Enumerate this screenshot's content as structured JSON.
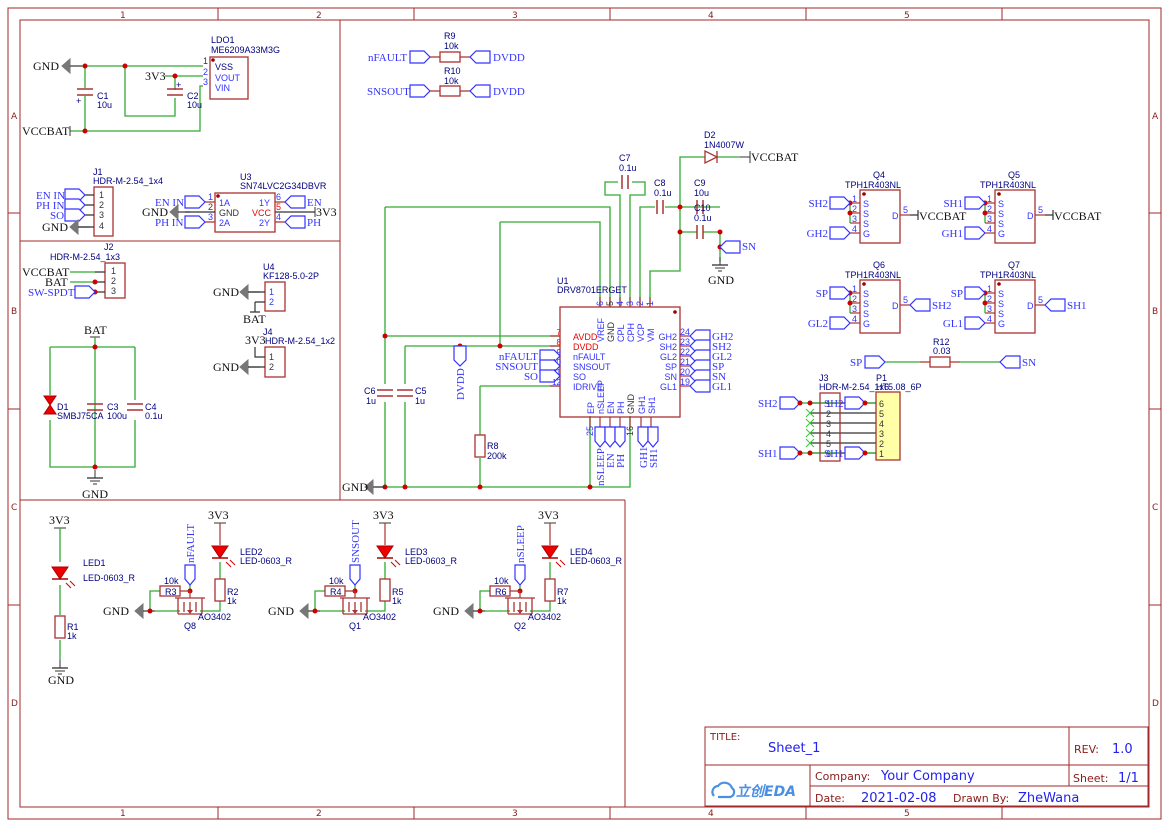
{
  "frame": {
    "columns": [
      "1",
      "2",
      "3",
      "4",
      "5"
    ],
    "rows": [
      "A",
      "B",
      "C",
      "D"
    ]
  },
  "power": {
    "gnd": "GND",
    "vccbat": "VCCBAT",
    "v3": "3V3",
    "bat": "BAT",
    "ldo": {
      "ref": "LDO1",
      "part": "ME6209A33M3G",
      "pins": [
        "VSS",
        "VOUT",
        "VIN"
      ],
      "nums": [
        "1",
        "2",
        "3"
      ]
    },
    "c1": {
      "ref": "C1",
      "val": "10u"
    },
    "c2": {
      "ref": "C2",
      "val": "10u"
    }
  },
  "j1": {
    "ref": "J1",
    "part": "HDR-M-2.54_1x4",
    "pins": [
      "1",
      "2",
      "3",
      "4"
    ],
    "nets": [
      "EN IN",
      "PH IN",
      "SO",
      "GND"
    ]
  },
  "u3": {
    "ref": "U3",
    "part": "SN74LVC2G34DBVR",
    "left_pins": [
      "1A",
      "GND",
      "2A"
    ],
    "left_nums": [
      "1",
      "2",
      "3"
    ],
    "right_pins": [
      "1Y",
      "VCC",
      "2Y"
    ],
    "right_nums": [
      "6",
      "5",
      "4"
    ],
    "left_nets": [
      "EN IN",
      "GND",
      "PH IN"
    ],
    "right_nets": [
      "EN",
      "3V3",
      "PH"
    ]
  },
  "j2": {
    "ref": "J2",
    "part": "HDR-M-2.54_1x3",
    "pins": [
      "1",
      "2",
      "3"
    ],
    "nets": [
      "VCCBAT",
      "BAT",
      "SW-SPDT"
    ]
  },
  "battery": {
    "d1": {
      "ref": "D1",
      "val": "SMBJ75CA"
    },
    "c3": {
      "ref": "C3",
      "val": "100u"
    },
    "c4": {
      "ref": "C4",
      "val": "0.1u"
    }
  },
  "u4": {
    "ref": "U4",
    "part": "KF128-5.0-2P",
    "pins": [
      "1",
      "2"
    ]
  },
  "j4": {
    "ref": "J4",
    "part": "HDR-M-2.54_1x2",
    "pins": [
      "1",
      "2"
    ]
  },
  "pullups": {
    "r9": {
      "ref": "R9",
      "val": "10k",
      "net": "nFAULT"
    },
    "r10": {
      "ref": "R10",
      "val": "10k",
      "net": "SNSOUT"
    },
    "to": "DVDD"
  },
  "u1": {
    "ref": "U1",
    "part": "DRV8701ERGET",
    "top_pins": [
      "VREF",
      "GND",
      "CPL",
      "CPH",
      "VCP",
      "VM"
    ],
    "top_nums": [
      "6",
      "5",
      "4",
      "3",
      "2",
      "1"
    ],
    "left_pins": [
      "AVDD",
      "DVDD",
      "nFAULT",
      "SNSOUT",
      "SO",
      "IDRIVE"
    ],
    "left_nums": [
      "7",
      "8",
      "9",
      "10",
      "11",
      "12"
    ],
    "right_pins": [
      "GH2",
      "SH2",
      "GL2",
      "SP",
      "SN",
      "GL1"
    ],
    "right_nums": [
      "24",
      "23",
      "22",
      "21",
      "20",
      "19"
    ],
    "bottom_pins": [
      "EP",
      "nSLEEP",
      "EN",
      "PH",
      "GND",
      "GH1",
      "SH1"
    ],
    "bottom_nums": [
      "25",
      "13",
      "14",
      "15",
      "16",
      "17",
      "18"
    ],
    "left_nets": [
      "nFAULT",
      "SNSOUT",
      "SO"
    ],
    "right_nets": [
      "GH2",
      "SH2",
      "GL2",
      "SP",
      "SN",
      "GL1"
    ],
    "bottom_nets": [
      "nSLEEP",
      "EN",
      "PH",
      "GH1",
      "SH1"
    ],
    "dvdd_net": "DVDD"
  },
  "passives": {
    "c5": {
      "ref": "C5",
      "val": "1u"
    },
    "c6": {
      "ref": "C6",
      "val": "1u"
    },
    "c7": {
      "ref": "C7",
      "val": "0.1u"
    },
    "c8": {
      "ref": "C8",
      "val": "0.1u"
    },
    "c9": {
      "ref": "C9",
      "val": "10u"
    },
    "c10": {
      "ref": "C10",
      "val": "0.1u"
    },
    "r8": {
      "ref": "R8",
      "val": "200k"
    },
    "d2": {
      "ref": "D2",
      "val": "1N4007W"
    },
    "sn": "SN"
  },
  "mosfets": [
    {
      "ref": "Q4",
      "part": "TPH1R403NL",
      "s_net": "SH2",
      "g_net": "GH2",
      "d_net": "VCCBAT"
    },
    {
      "ref": "Q5",
      "part": "TPH1R403NL",
      "s_net": "SH1",
      "g_net": "GH1",
      "d_net": "VCCBAT"
    },
    {
      "ref": "Q6",
      "part": "TPH1R403NL",
      "s_net": "SP",
      "g_net": "GL2",
      "d_net": "SH2"
    },
    {
      "ref": "Q7",
      "part": "TPH1R403NL",
      "s_net": "SP",
      "g_net": "GL1",
      "d_net": "SH1"
    }
  ],
  "mos_pins": {
    "labels": [
      "S",
      "S",
      "S",
      "G",
      "D"
    ],
    "nums": [
      "1",
      "2",
      "3",
      "4",
      "5"
    ]
  },
  "r12": {
    "ref": "R12",
    "val": "0.03",
    "left": "SP",
    "right": "SN"
  },
  "j3": {
    "ref": "J3",
    "part": "HDR-M-2.54_1x6",
    "pins": [
      "1",
      "2",
      "3",
      "4",
      "5",
      "6"
    ],
    "nets": [
      "SH2",
      "SH1"
    ]
  },
  "p1": {
    "ref": "P1",
    "part": "HT5.08_6P",
    "pins": [
      "6",
      "5",
      "4",
      "3",
      "2",
      "1"
    ]
  },
  "led1": {
    "ref": "LED1",
    "part": "LED-0603_R",
    "r": {
      "ref": "R1",
      "val": "1k"
    },
    "top": "3V3",
    "bot": "GND"
  },
  "led_drivers": [
    {
      "net": "nFAULT",
      "rg": "R3",
      "rg_val": "10k",
      "q": "Q8",
      "q_part": "AO3402",
      "led": "LED2",
      "led_part": "LED-0603_R",
      "rl": "R2",
      "rl_val": "1k"
    },
    {
      "net": "SNSOUT",
      "rg": "R4",
      "rg_val": "10k",
      "q": "Q1",
      "q_part": "AO3402",
      "led": "LED3",
      "led_part": "LED-0603_R",
      "rl": "R5",
      "rl_val": "1k"
    },
    {
      "net": "nSLEEP",
      "rg": "R6",
      "rg_val": "10k",
      "q": "Q2",
      "q_part": "AO3402",
      "led": "LED4",
      "led_part": "LED-0603_R",
      "rl": "R7",
      "rl_val": "1k"
    }
  ],
  "title_block": {
    "title_label": "TITLE:",
    "title": "Sheet_1",
    "rev_label": "REV:",
    "rev": "1.0",
    "company_label": "Company:",
    "company": "Your Company",
    "sheet_label": "Sheet:",
    "sheet": "1/1",
    "date_label": "Date:",
    "date": "2021-02-08",
    "drawn_label": "Drawn By:",
    "drawn": "ZheWana",
    "logo": "立创EDA"
  }
}
